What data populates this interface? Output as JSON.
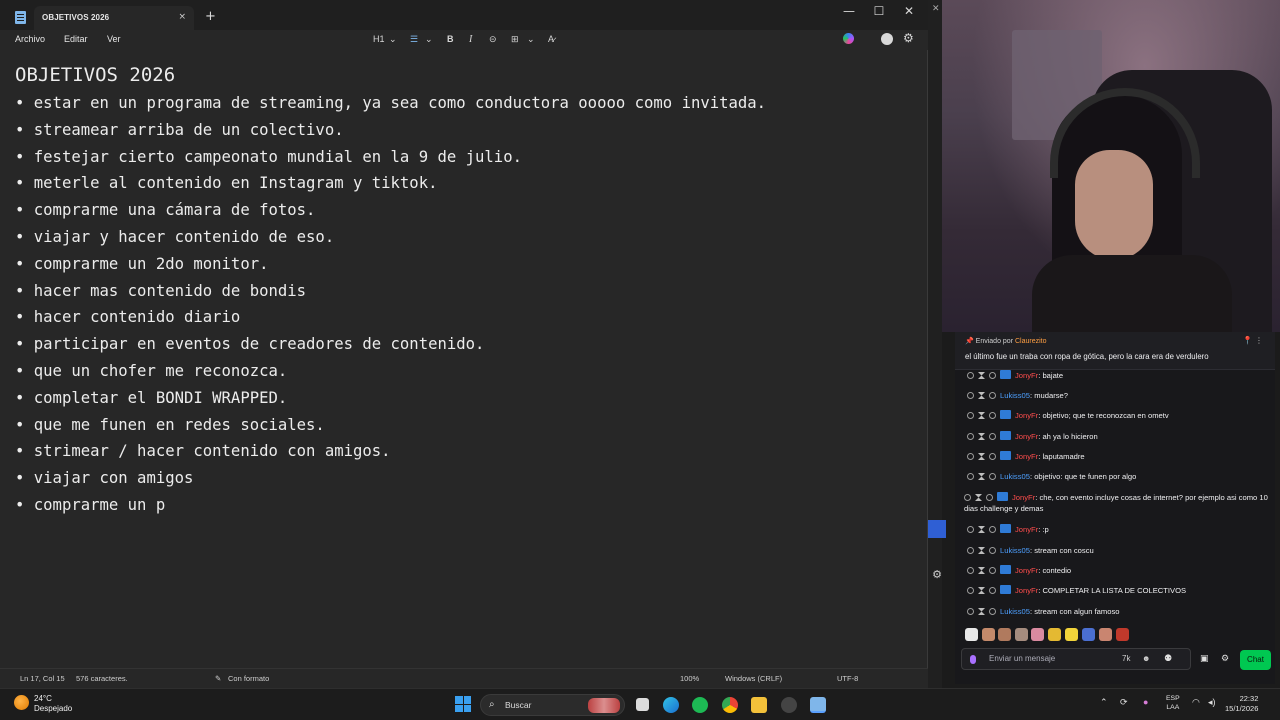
{
  "window": {
    "tab_title": "OBJETIVOS 2026",
    "tab_close": "×",
    "new_tab": "+",
    "minimize": "—",
    "maximize": "☐",
    "close": "✕"
  },
  "menu": {
    "file": "Archivo",
    "edit": "Editar",
    "view": "Ver"
  },
  "toolbar": {
    "heading": "H1",
    "chevron": "⌄",
    "list": "☰",
    "bold": "B",
    "italic": "I",
    "link": "⊝",
    "table": "⊞",
    "clear": "A̷"
  },
  "document": {
    "title": "OBJETIVOS 2026",
    "items": [
      "estar en un programa de streaming, ya sea como conductora ooooo como invitada.",
      "streamear arriba de un colectivo.",
      "festejar cierto campeonato mundial en la 9 de julio.",
      "meterle al contenido en Instagram y tiktok.",
      "comprarme una cámara de fotos.",
      "viajar y hacer contenido de eso.",
      "comprarme un 2do monitor.",
      "hacer mas contenido de bondis",
      "hacer contenido diario",
      "participar en eventos de creadores de contenido.",
      "que un chofer me reconozca.",
      "completar el BONDI WRAPPED.",
      "que me funen en redes sociales.",
      "strimear / hacer contenido con amigos.",
      "viajar con amigos",
      "comprarme un p"
    ]
  },
  "status": {
    "position": "Ln 17, Col 15",
    "chars": "576 caracteres.",
    "format": "Con formato",
    "zoom": "100%",
    "eol": "Windows (CRLF)",
    "encoding": "UTF-8"
  },
  "chat": {
    "pinned_label": "Enviado por",
    "pinned_user": "Claurezito",
    "pinned_message": "el último fue un traba con ropa de gótica, pero la cara era de verdulero",
    "messages": [
      {
        "user": "JonyFr",
        "text": ": bajate",
        "color": "#ff4d4d",
        "prime": true
      },
      {
        "user": "Lukiss05",
        "text": ": mudarse?",
        "color": "#4ea0ff",
        "prime": false
      },
      {
        "user": "JonyFr",
        "text": ": objetivo; que te reconozcan en ometv",
        "color": "#ff4d4d",
        "prime": true
      },
      {
        "user": "JonyFr",
        "text": ": ah ya lo hicieron",
        "color": "#ff4d4d",
        "prime": true
      },
      {
        "user": "JonyFr",
        "text": ": laputamadre",
        "color": "#ff4d4d",
        "prime": true
      },
      {
        "user": "Lukiss05",
        "text": ": objetivo: que te funen por algo",
        "color": "#4ea0ff",
        "prime": false
      },
      {
        "user": "JonyFr",
        "text": ": che, con evento incluye cosas de internet? por ejemplo asi como 10 dias challenge y demas",
        "color": "#ff4d4d",
        "prime": true
      },
      {
        "user": "JonyFr",
        "text": ": :p",
        "color": "#ff4d4d",
        "prime": true
      },
      {
        "user": "Lukiss05",
        "text": ": stream con coscu",
        "color": "#4ea0ff",
        "prime": false
      },
      {
        "user": "JonyFr",
        "text": ": contedio",
        "color": "#ff4d4d",
        "prime": true
      },
      {
        "user": "JonyFr",
        "text": ": COMPLETAR LA LISTA DE COLECTIVOS",
        "color": "#ff4d4d",
        "prime": true
      },
      {
        "user": "Lukiss05",
        "text": ": stream con algun famoso",
        "color": "#4ea0ff",
        "prime": false
      }
    ],
    "input_placeholder": "Enviar un mensaje",
    "chat_button": "Chat",
    "points": "7k"
  },
  "taskbar": {
    "temperature": "24°C",
    "weather": "Despejado",
    "search": "Buscar",
    "lang_top": "ESP",
    "lang_bottom": "LAA",
    "time": "22:32",
    "date": "15/1/2026"
  }
}
